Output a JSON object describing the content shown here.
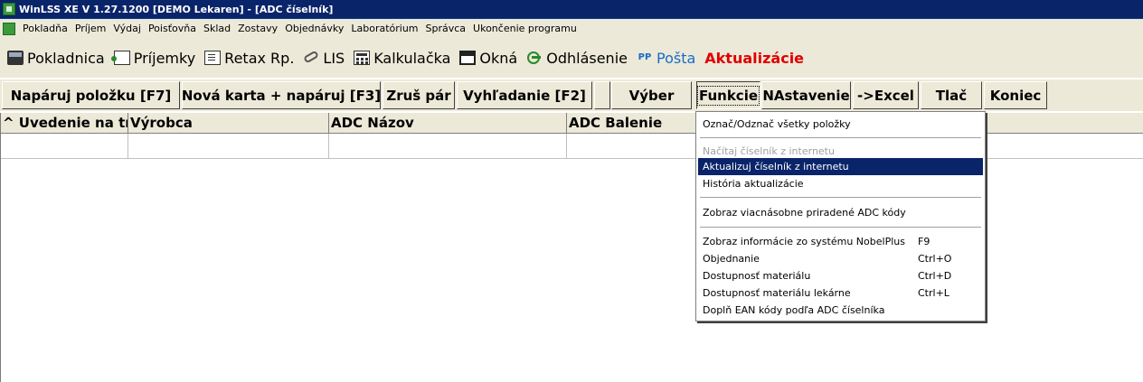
{
  "title": "WinLSS XE V 1.27.1200  [DEMO Lekaren]  - [ADC číselník]",
  "menu": [
    "Pokladňa",
    "Príjem",
    "Výdaj",
    "Poisťovňa",
    "Sklad",
    "Zostavy",
    "Objednávky",
    "Laboratórium",
    "Správca",
    "Ukončenie programu"
  ],
  "toolbar": [
    {
      "label": "Pokladnica",
      "icon": "cash-register-icon"
    },
    {
      "label": "Príjemky",
      "icon": "receipt-icon"
    },
    {
      "label": "Retax Rp.",
      "icon": "retax-icon"
    },
    {
      "label": "LIS",
      "icon": "lis-icon"
    },
    {
      "label": "Kalkulačka",
      "icon": "calculator-icon"
    },
    {
      "label": "Okná",
      "icon": "windows-icon"
    },
    {
      "label": "Odhlásenie",
      "icon": "logout-icon"
    },
    {
      "label": "Pošta",
      "icon": "mail-icon",
      "color": "#1a6ac8"
    },
    {
      "label": "Aktualizácie",
      "color": "#e00000"
    }
  ],
  "buttons": {
    "pair": "Napáruj položku [F7]",
    "new_card": "Nová karta + napáruj [F3]",
    "cancel_pair": "Zruš pár",
    "search": "Vyhľadanie [F2]",
    "select": "Výber",
    "functions": "Funkcie",
    "settings": "NAstavenie",
    "excel": "->Excel",
    "print": "Tlač",
    "end": "Koniec"
  },
  "grid": {
    "columns": [
      "^ Uvedenie na trh",
      "Výrobca",
      "ADC Názov",
      "ADC Balenie"
    ]
  },
  "dropdown": {
    "items": [
      {
        "label": "Označ/Odznač všetky položky"
      },
      {
        "label": "Načítaj číselník z internetu",
        "disabled": true
      },
      {
        "label": "Aktualizuj číselník z internetu",
        "highlighted": true
      },
      {
        "label": "História aktualizácie"
      },
      {
        "label": "Zobraz viacnásobne priradené ADC kódy"
      },
      {
        "label": "Zobraz informácie zo systému NobelPlus",
        "shortcut": "F9"
      },
      {
        "label": "Objednanie",
        "shortcut": "Ctrl+O"
      },
      {
        "label": "Dostupnosť materiálu",
        "shortcut": "Ctrl+D"
      },
      {
        "label": "Dostupnosť materiálu lekárne",
        "shortcut": "Ctrl+L"
      },
      {
        "label": "Doplň EAN kódy podľa ADC číselníka"
      }
    ]
  },
  "colors": {
    "titlebar": "#0a246a",
    "highlight": "#0a246a",
    "mail": "#1a6ac8",
    "update": "#e00000"
  }
}
